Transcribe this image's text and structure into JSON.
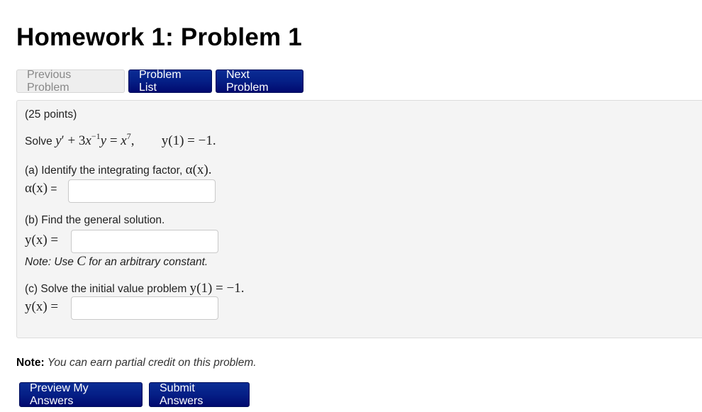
{
  "page": {
    "title": "Homework 1: Problem 1"
  },
  "nav": {
    "previous_label": "Previous Problem",
    "list_label": "Problem List",
    "next_label": "Next Problem"
  },
  "problem": {
    "points": "(25 points)",
    "statement_prefix": "Solve",
    "equation": {
      "lhs_y": "y",
      "prime": "′",
      "plus": " + 3",
      "x": "x",
      "exp_neg1": "−1",
      "y": "y",
      "eq": " = ",
      "rhs_x": "x",
      "exp_7": "7",
      "comma": ",",
      "ic": "y(1) = −1."
    },
    "part_a": {
      "prompt": "(a) Identify the integrating factor,",
      "prompt_math": "α(x).",
      "label_math": "α(x)",
      "label_eq": " =",
      "value": ""
    },
    "part_b": {
      "prompt": "(b) Find the general solution.",
      "label_math": "y(x) =",
      "value": "",
      "note_prefix": "Note: Use",
      "note_math": "C",
      "note_suffix": "for an arbitrary constant."
    },
    "part_c": {
      "prompt": "(c) Solve the initial value problem",
      "prompt_math": "y(1) = −1.",
      "label_math": "y(x) =",
      "value": ""
    }
  },
  "footer": {
    "note_label": "Note:",
    "note_text": "You can earn partial credit on this problem.",
    "preview_label": "Preview My Answers",
    "submit_label": "Submit Answers"
  },
  "colors": {
    "primary_button": "#051f86",
    "disabled_button": "#eeeeee",
    "problem_bg": "#f4f4f4"
  }
}
